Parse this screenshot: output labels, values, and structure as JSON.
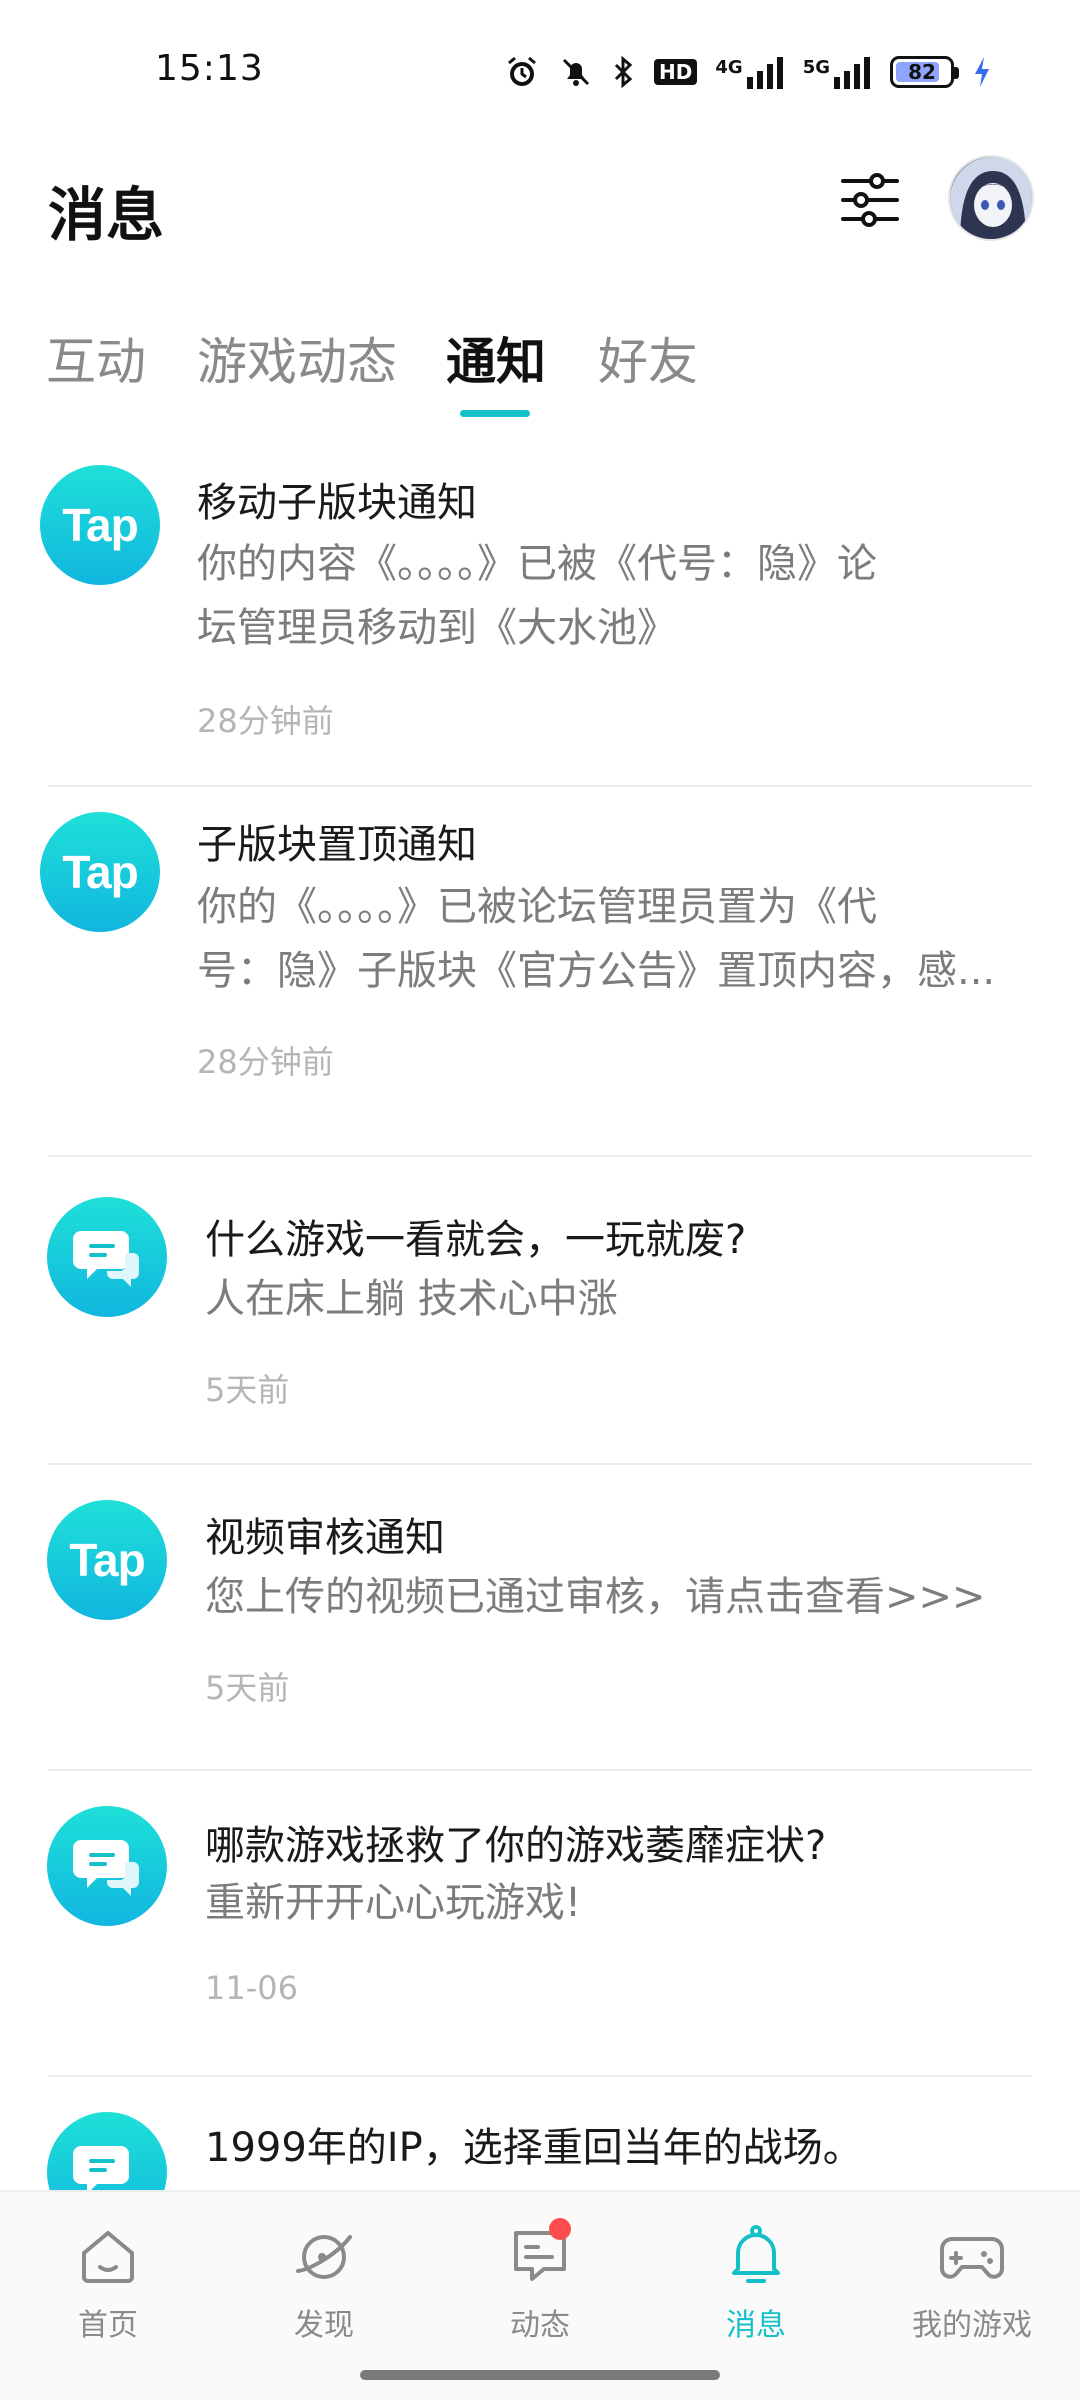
{
  "status_bar": {
    "time": "15:13",
    "network_1": "4G",
    "network_2": "5G",
    "hd": "HD",
    "battery_level": "82",
    "battery_fraction": 0.82,
    "icons": [
      "alarm-icon",
      "mute-icon",
      "bluetooth-icon",
      "hd-icon",
      "signal-4g-icon",
      "signal-5g-icon",
      "battery-icon",
      "charging-icon"
    ]
  },
  "header": {
    "title": "消息",
    "filter_icon": "sliders-icon",
    "avatar": "avatar"
  },
  "tabs": [
    {
      "label": "互动",
      "active": false
    },
    {
      "label": "游戏动态",
      "active": false
    },
    {
      "label": "通知",
      "active": true
    },
    {
      "label": "好友",
      "active": false
    }
  ],
  "notifications": [
    {
      "icon": "tap-logo",
      "icon_text": "Tap",
      "title": "移动子版块通知",
      "body_line1": "你的内容《。。。。》已被《代号：隐》论",
      "body_line2": "坛管理员移动到《大水池》",
      "time": "28分钟前"
    },
    {
      "icon": "tap-logo",
      "icon_text": "Tap",
      "title": "子版块置顶通知",
      "body_line1": "你的《。。。。》已被论坛管理员置为《代",
      "body_line2": "号：隐》子版块《官方公告》置顶内容，感...",
      "time": "28分钟前"
    },
    {
      "icon": "chat-bubble-icon",
      "title": "什么游戏一看就会，一玩就废?",
      "body_line1": "人在床上躺 技术心中涨",
      "time": "5天前"
    },
    {
      "icon": "tap-logo",
      "icon_text": "Tap",
      "title": "视频审核通知",
      "body_line1": "您上传的视频已通过审核，请点击查看>>>",
      "time": "5天前"
    },
    {
      "icon": "chat-bubble-icon",
      "title": "哪款游戏拯救了你的游戏萎靡症状?",
      "body_line1": "重新开开心心玩游戏!",
      "time": "11-06"
    },
    {
      "icon": "chat-bubble-icon",
      "title": "1999年的IP，选择重回当年的战场。"
    }
  ],
  "bottom_nav": [
    {
      "label": "首页",
      "icon": "home-icon",
      "active": false
    },
    {
      "label": "发现",
      "icon": "discover-icon",
      "active": false
    },
    {
      "label": "动态",
      "icon": "feed-icon",
      "active": false,
      "badge": true
    },
    {
      "label": "消息",
      "icon": "bell-icon",
      "active": true
    },
    {
      "label": "我的游戏",
      "icon": "gamepad-icon",
      "active": false
    }
  ],
  "colors": {
    "accent": "#14c0c8",
    "badge": "#ff4d4f",
    "text_primary": "#1a1a1a",
    "text_secondary": "#7c7c7c",
    "text_time": "#b5b5b5"
  }
}
